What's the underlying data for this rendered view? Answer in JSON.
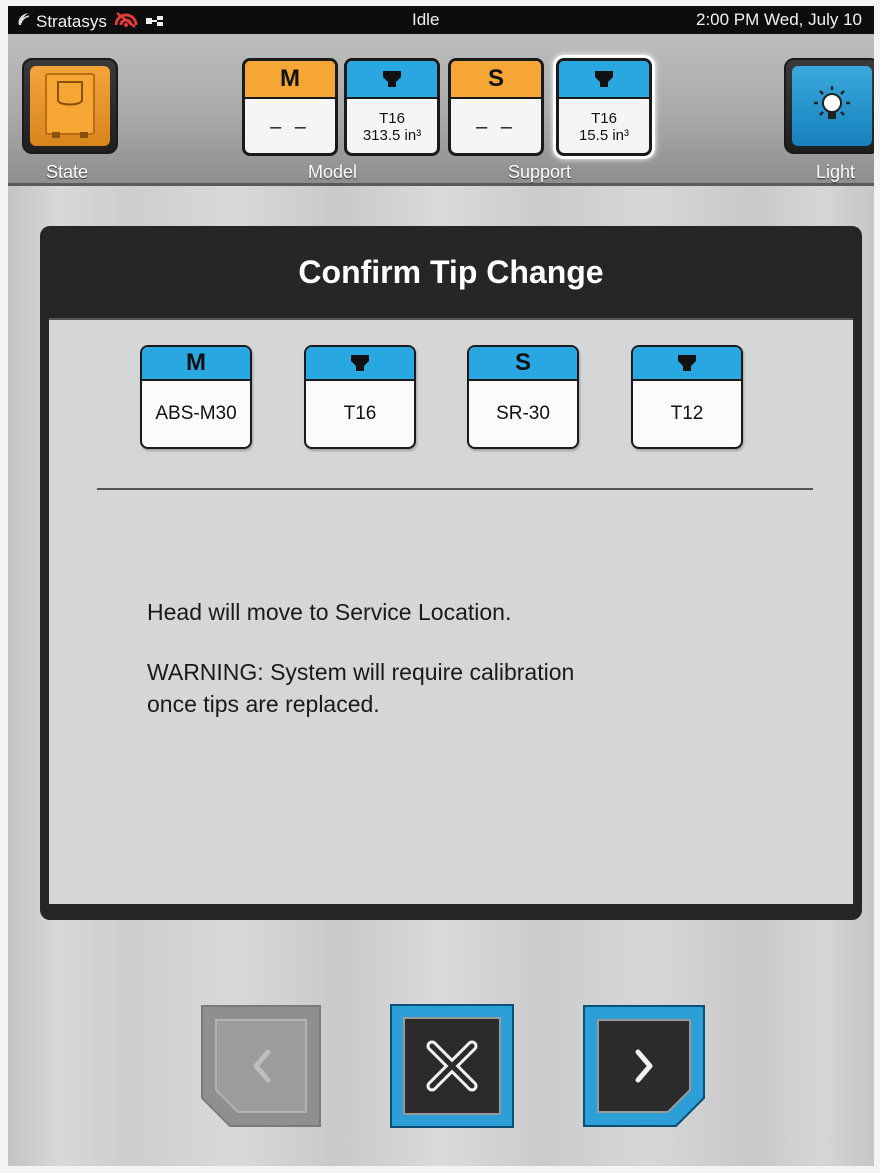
{
  "status_bar": {
    "brand": "Stratasys",
    "state": "Idle",
    "datetime": "2:00 PM Wed, July 10"
  },
  "toolbar": {
    "state_label": "State",
    "light_label": "Light",
    "model_label": "Model",
    "support_label": "Support",
    "materials": [
      {
        "head": "M",
        "line1": "– –",
        "line2": "",
        "color": "#f6a634"
      },
      {
        "head": "",
        "line1": "T16",
        "line2": "313.5 in³",
        "color": "#29a7e1"
      },
      {
        "head": "S",
        "line1": "– –",
        "line2": "",
        "color": "#f6a634"
      },
      {
        "head": "",
        "line1": "T16",
        "line2": "15.5 in³",
        "color": "#29a7e1"
      }
    ]
  },
  "dialog": {
    "title": "Confirm Tip Change",
    "tiles": [
      {
        "head": "M",
        "label": "ABS-M30"
      },
      {
        "head": "",
        "label": "T16"
      },
      {
        "head": "S",
        "label": "SR-30"
      },
      {
        "head": "",
        "label": "T12"
      }
    ],
    "message1": "Head will move to Service Location.",
    "message2_line1": "WARNING:  System will require calibration",
    "message2_line2": "once tips are replaced."
  },
  "colors": {
    "accent_blue": "#29a7e1",
    "accent_orange": "#f6a634",
    "dialog_dark": "#262626"
  }
}
